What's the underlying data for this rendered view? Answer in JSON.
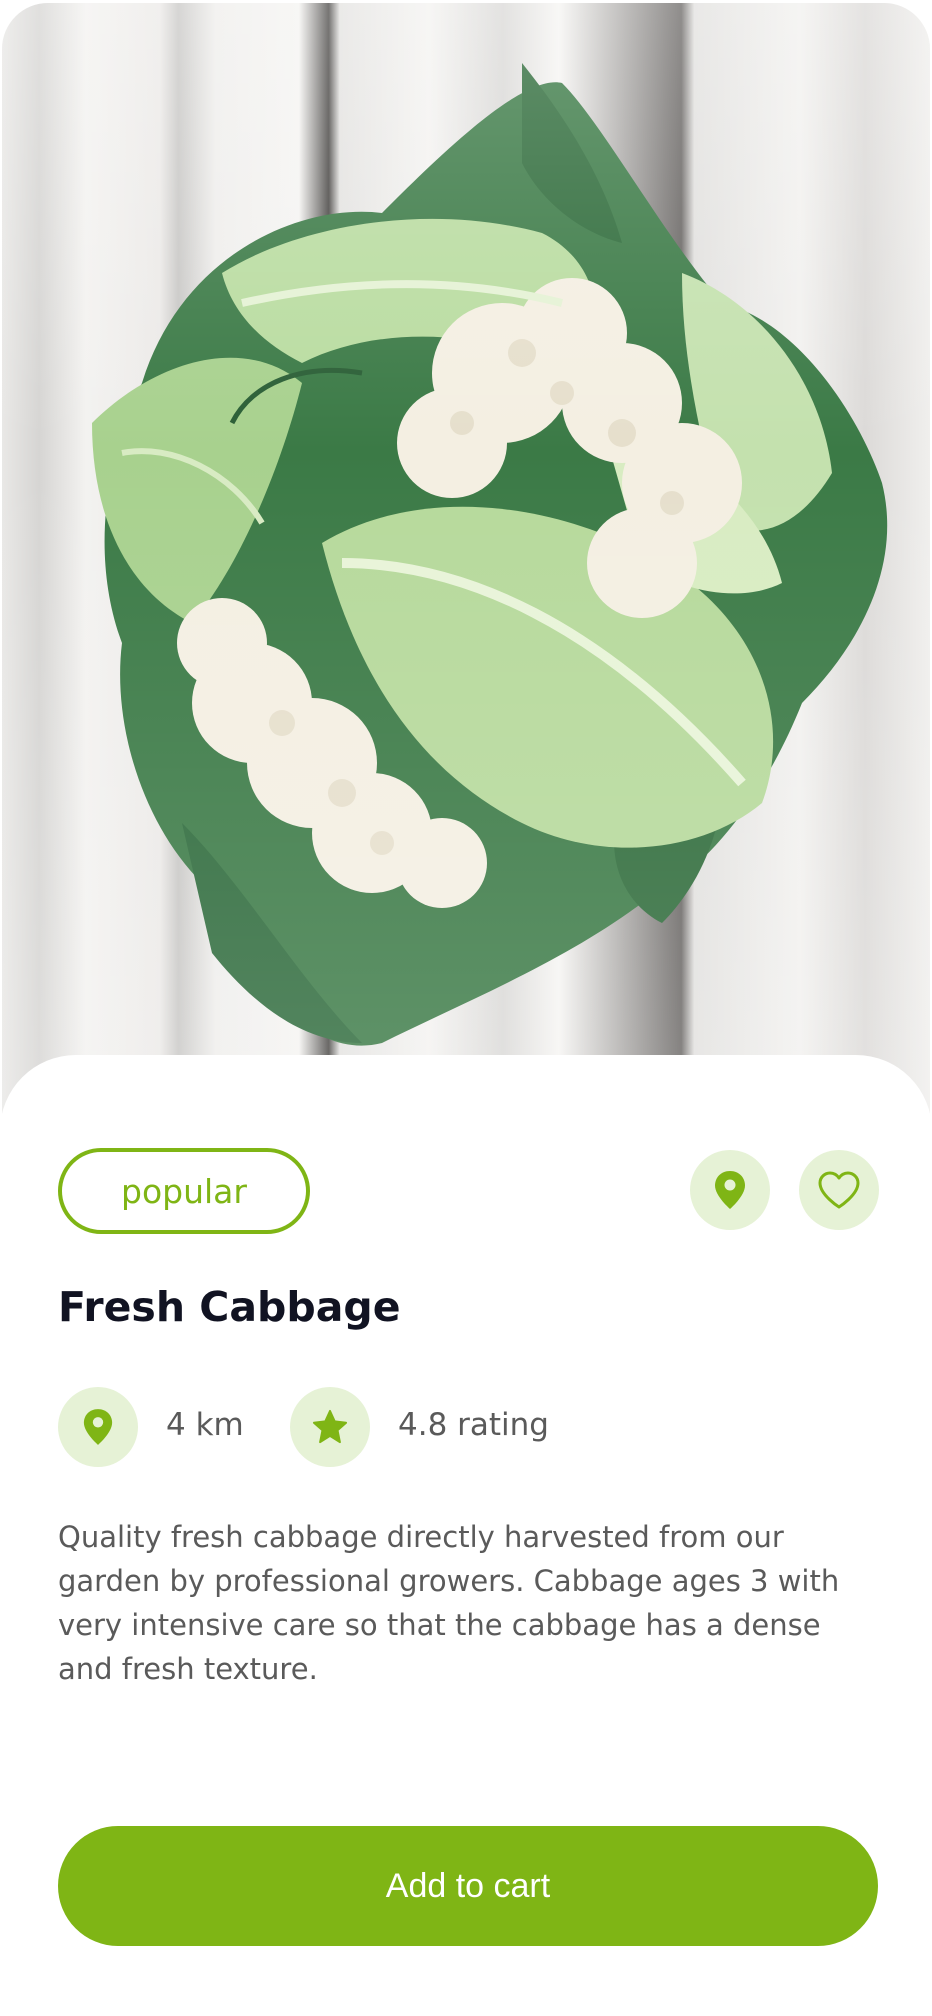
{
  "product": {
    "tag_label": "popular",
    "name": "Fresh Cabbage",
    "distance": "4 km",
    "rating": "4.8 rating",
    "description": "Quality fresh cabbage directly harvested from our garden by professional growers. Cabbage ages 3 with very intensive care so that the cabbage has a dense and fresh texture."
  },
  "actions": {
    "location_icon": "map-pin-icon",
    "favorite_icon": "heart-icon",
    "add_to_cart_label": "Add to cart"
  },
  "meta_icons": {
    "distance_icon": "map-pin-icon",
    "rating_icon": "star-icon"
  },
  "colors": {
    "accent": "#7fb515",
    "accent_light": "#e6f2d6",
    "title": "#111322",
    "body_text": "#5a5a5a"
  }
}
